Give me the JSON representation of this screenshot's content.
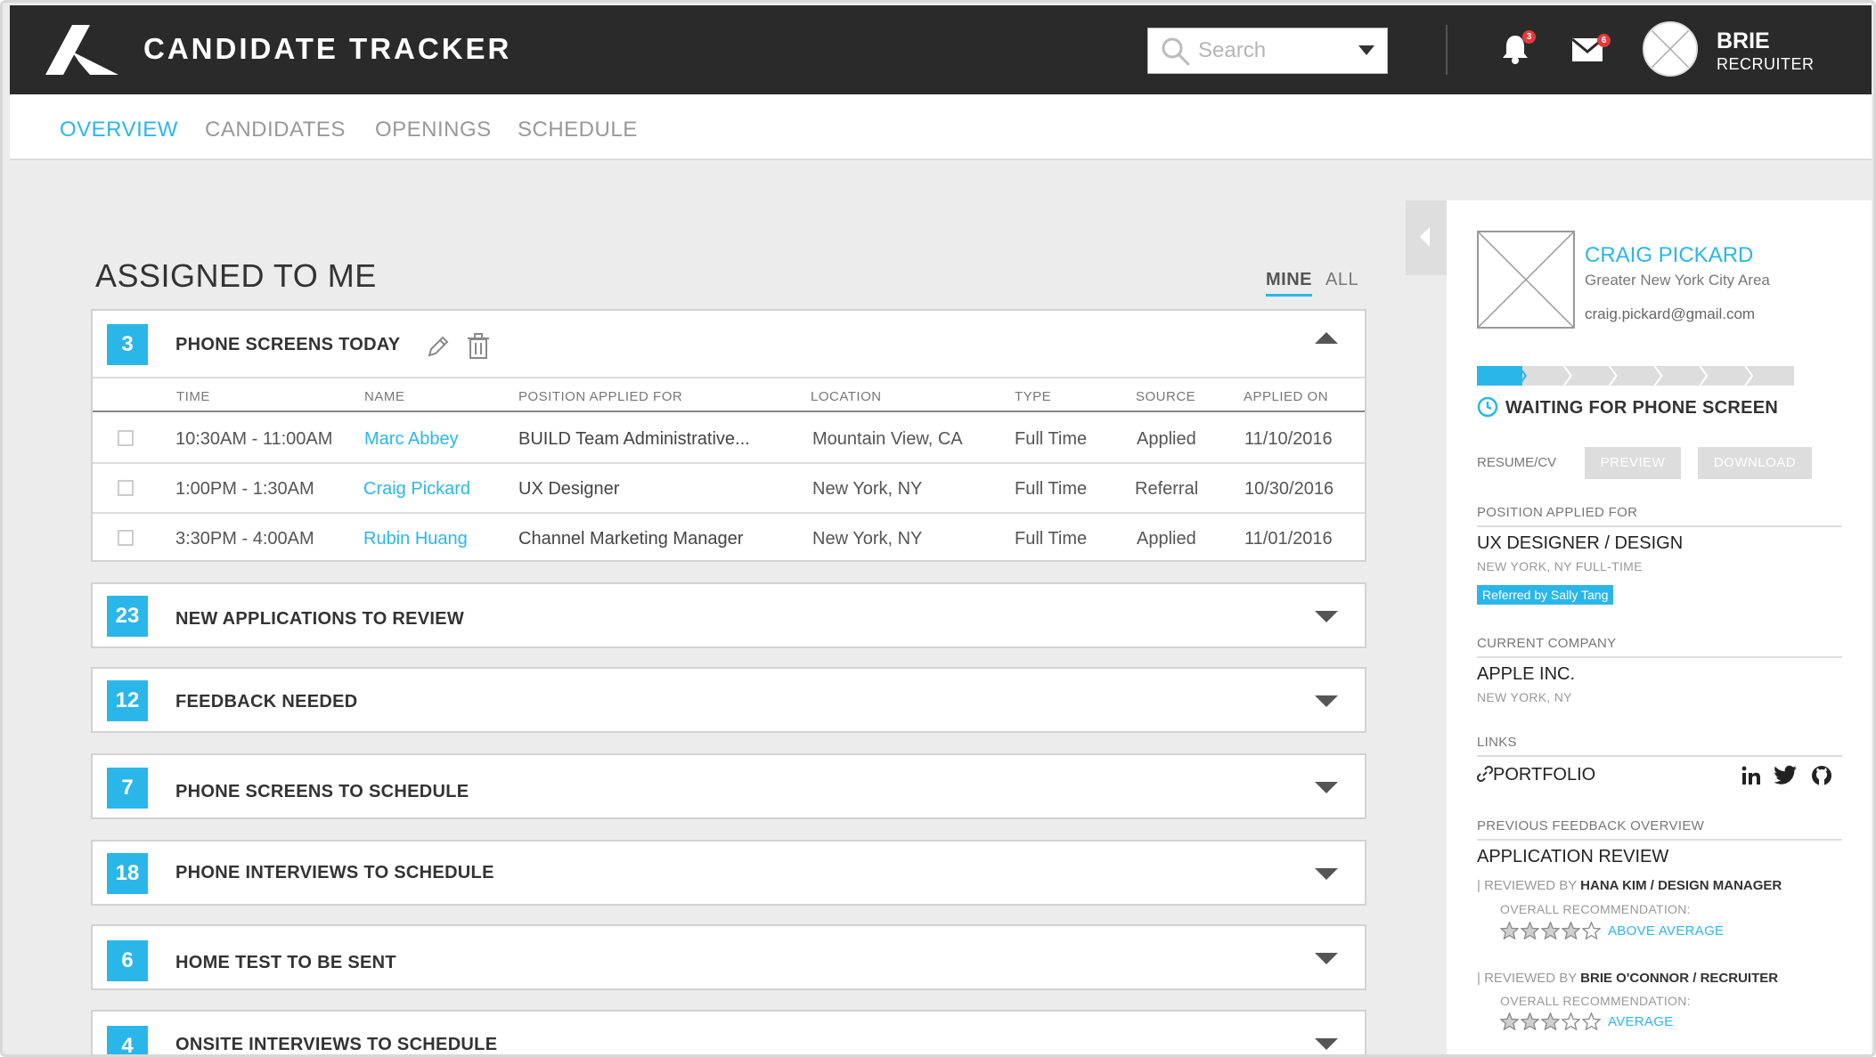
{
  "app": {
    "title": "CANDIDATE TRACKER"
  },
  "search": {
    "placeholder": "Search"
  },
  "notifications": {
    "bell_count": "3",
    "mail_count": "6"
  },
  "user": {
    "name": "BRIE",
    "role": "RECRUITER"
  },
  "nav": {
    "tabs": [
      "OVERVIEW",
      "CANDIDATES",
      "OPENINGS",
      "SCHEDULE"
    ],
    "active": "OVERVIEW"
  },
  "main": {
    "title": "ASSIGNED TO ME",
    "filters": {
      "mine": "MINE",
      "all": "ALL",
      "active": "MINE"
    }
  },
  "groups": [
    {
      "count": "3",
      "title": "PHONE SCREENS TODAY",
      "expanded": true,
      "columns": [
        "TIME",
        "NAME",
        "POSITION APPLIED FOR",
        "LOCATION",
        "TYPE",
        "SOURCE",
        "APPLIED ON"
      ],
      "rows": [
        {
          "time": "10:30AM - 11:00AM",
          "name": "Marc Abbey",
          "position": "BUILD Team Administrative...",
          "location": "Mountain View, CA",
          "type": "Full Time",
          "source": "Applied",
          "applied_on": "11/10/2016"
        },
        {
          "time": "1:00PM - 1:30AM",
          "name": "Craig Pickard",
          "position": "UX Designer",
          "location": "New York, NY",
          "type": "Full Time",
          "source": "Referral",
          "applied_on": "10/30/2016"
        },
        {
          "time": "3:30PM - 4:00AM",
          "name": "Rubin Huang",
          "position": "Channel Marketing Manager",
          "location": "New York, NY",
          "type": "Full Time",
          "source": "Applied",
          "applied_on": "11/01/2016"
        }
      ]
    },
    {
      "count": "23",
      "title": "NEW APPLICATIONS TO REVIEW",
      "expanded": false
    },
    {
      "count": "12",
      "title": "FEEDBACK NEEDED",
      "expanded": false
    },
    {
      "count": "7",
      "title": "PHONE SCREENS TO SCHEDULE",
      "expanded": false
    },
    {
      "count": "18",
      "title": "PHONE INTERVIEWS TO SCHEDULE",
      "expanded": false
    },
    {
      "count": "6",
      "title": "HOME TEST TO BE SENT",
      "expanded": false
    },
    {
      "count": "4",
      "title": "ONSITE INTERVIEWS TO SCHEDULE",
      "expanded": false
    }
  ],
  "candidate": {
    "name": "CRAIG PICKARD",
    "area": "Greater New York City Area",
    "email": "craig.pickard@gmail.com",
    "progress_stage": 1,
    "progress_stages_total": 7,
    "status": "WAITING FOR PHONE SCREEN",
    "resume_label": "RESUME/CV",
    "preview_label": "PREVIEW",
    "download_label": "DOWNLOAD",
    "position_label": "POSITION APPLIED FOR",
    "position": "UX DESIGNER / DESIGN",
    "position_meta": "NEW YORK, NY  FULL-TIME",
    "referral": "Referred by Sally Tang",
    "company_label": "CURRENT COMPANY",
    "company": "APPLE INC.",
    "company_location": "NEW YORK, NY",
    "links_label": "LINKS",
    "portfolio": "PORTFOLIO",
    "social": [
      "linkedin-icon",
      "twitter-icon",
      "github-icon"
    ],
    "feedback_label": "PREVIOUS FEEDBACK OVERVIEW",
    "feedback_title": "APPLICATION REVIEW",
    "reviews": [
      {
        "prefix": "| REVIEWED BY ",
        "reviewer": "HANA KIM / DESIGN MANAGER",
        "overall_label": "OVERALL RECOMMENDATION:",
        "stars": 4,
        "max_stars": 5,
        "rating": "ABOVE AVERAGE"
      },
      {
        "prefix": "| REVIEWED BY ",
        "reviewer": "BRIE O'CONNOR / RECRUITER",
        "overall_label": "OVERALL RECOMMENDATION:",
        "stars": 3,
        "max_stars": 5,
        "rating": "AVERAGE"
      }
    ]
  },
  "colors": {
    "accent": "#2bb6e9",
    "header_bg": "#2a2a2a",
    "badge": "#e23b3b"
  }
}
